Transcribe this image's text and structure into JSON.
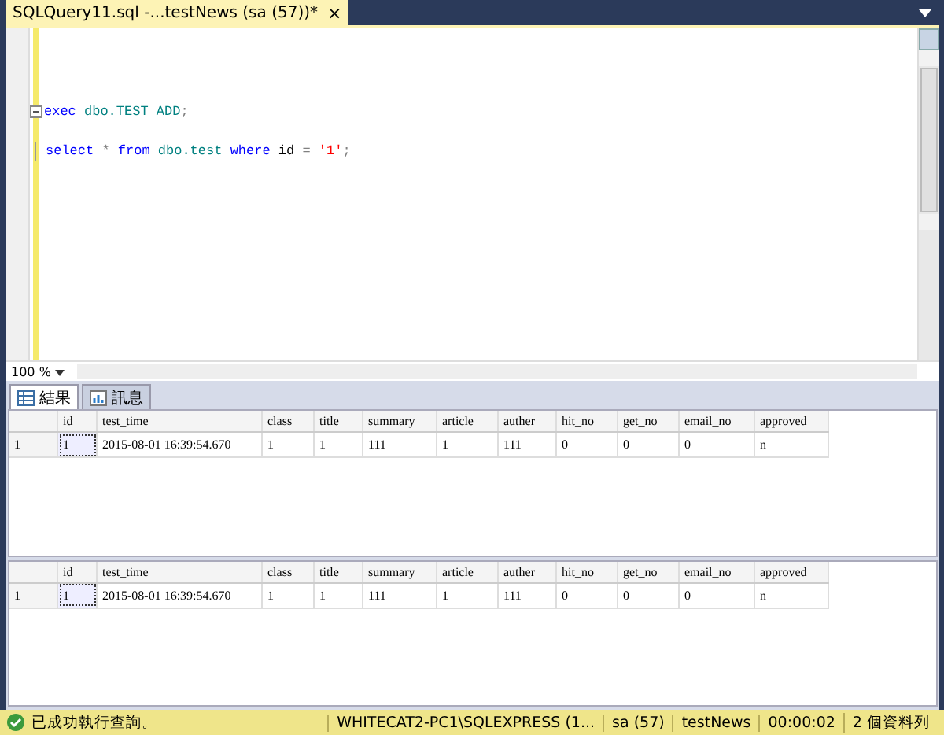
{
  "document_tab": {
    "title": "SQLQuery11.sql -...testNews (sa (57))*",
    "close": "×",
    "selected": true
  },
  "editor": {
    "lines": [
      {
        "collapsible": true,
        "tokens": [
          {
            "text": "exec",
            "kind": "keyword",
            "gap": false
          },
          {
            "text": "dbo.TEST_ADD",
            "kind": "object",
            "gap": true
          },
          {
            "text": ";",
            "kind": "operator",
            "gap": false
          }
        ]
      },
      {
        "collapsible": false,
        "tokens": [
          {
            "text": "select",
            "kind": "keyword",
            "gap": false
          },
          {
            "text": "*",
            "kind": "operator",
            "gap": true
          },
          {
            "text": "from",
            "kind": "keyword",
            "gap": true
          },
          {
            "text": "dbo.test",
            "kind": "object",
            "gap": true
          },
          {
            "text": "where",
            "kind": "keyword",
            "gap": true
          },
          {
            "text": "id",
            "kind": "plain",
            "gap": true
          },
          {
            "text": "=",
            "kind": "operator",
            "gap": true
          },
          {
            "text": "'1'",
            "kind": "string",
            "gap": true
          },
          {
            "text": ";",
            "kind": "operator",
            "gap": false
          }
        ]
      }
    ],
    "zoom": "100 %"
  },
  "result_tabs": [
    {
      "label": "結果",
      "selected": true
    },
    {
      "label": "訊息",
      "selected": false
    }
  ],
  "grids": [
    {
      "columns": [
        "id",
        "test_time",
        "class",
        "title",
        "summary",
        "article",
        "auther",
        "hit_no",
        "get_no",
        "email_no",
        "approved"
      ],
      "rows": [
        {
          "number": "1",
          "cells": [
            {
              "text": "1",
              "selected": true
            },
            {
              "text": "2015-08-01 16:39:54.670",
              "selected": false
            },
            {
              "text": "1",
              "selected": false
            },
            {
              "text": "1",
              "selected": false
            },
            {
              "text": "111",
              "selected": false
            },
            {
              "text": "1",
              "selected": false
            },
            {
              "text": "111",
              "selected": false
            },
            {
              "text": "0",
              "selected": false
            },
            {
              "text": "0",
              "selected": false
            },
            {
              "text": "0",
              "selected": false
            },
            {
              "text": "n",
              "selected": false
            }
          ]
        }
      ]
    },
    {
      "columns": [
        "id",
        "test_time",
        "class",
        "title",
        "summary",
        "article",
        "auther",
        "hit_no",
        "get_no",
        "email_no",
        "approved"
      ],
      "rows": [
        {
          "number": "1",
          "cells": [
            {
              "text": "1",
              "selected": true
            },
            {
              "text": "2015-08-01 16:39:54.670",
              "selected": false
            },
            {
              "text": "1",
              "selected": false
            },
            {
              "text": "1",
              "selected": false
            },
            {
              "text": "111",
              "selected": false
            },
            {
              "text": "1",
              "selected": false
            },
            {
              "text": "111",
              "selected": false
            },
            {
              "text": "0",
              "selected": false
            },
            {
              "text": "0",
              "selected": false
            },
            {
              "text": "0",
              "selected": false
            },
            {
              "text": "n",
              "selected": false
            }
          ]
        }
      ]
    }
  ],
  "status_bar": {
    "message": "已成功執行查詢。",
    "segments": [
      "WHITECAT2-PC1\\SQLEXPRESS (1...",
      "sa (57)",
      "testNews",
      "00:00:02",
      "2 個資料列"
    ]
  }
}
